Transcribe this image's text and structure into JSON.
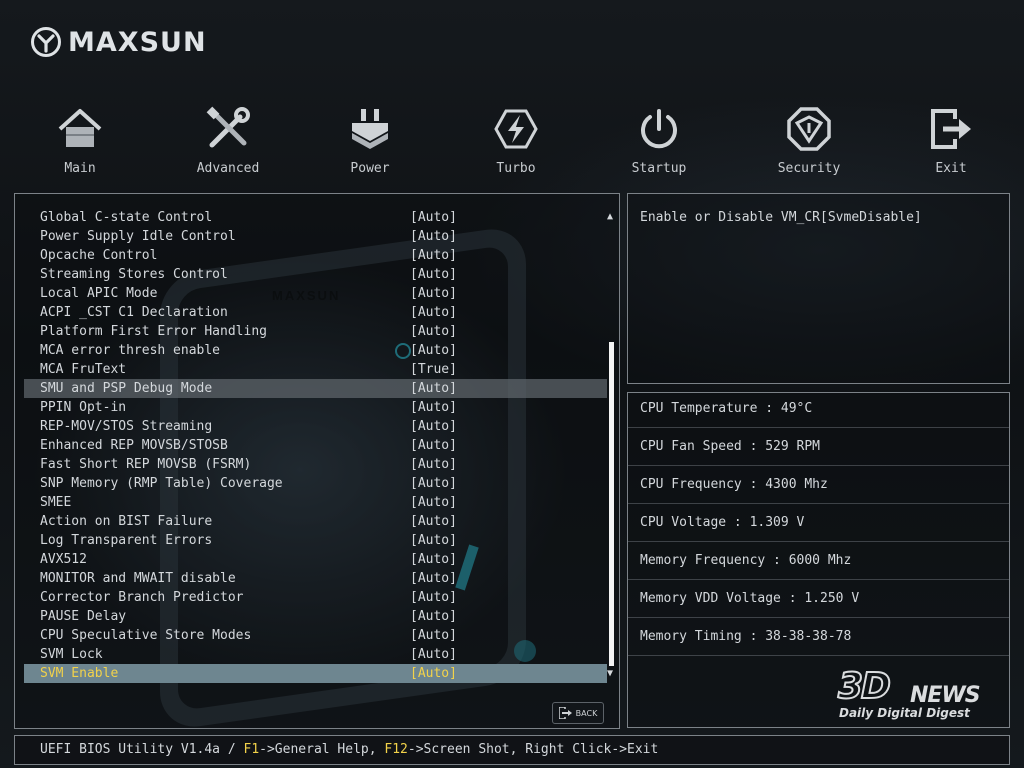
{
  "brand": {
    "name": "MAXSUN"
  },
  "background": {
    "watermark": "MAXSUN"
  },
  "nav": [
    {
      "label": "Main",
      "icon": "home-icon"
    },
    {
      "label": "Advanced",
      "icon": "tools-icon"
    },
    {
      "label": "Power",
      "icon": "power-chip-icon"
    },
    {
      "label": "Turbo",
      "icon": "lightning-icon"
    },
    {
      "label": "Startup",
      "icon": "power-button-icon"
    },
    {
      "label": "Security",
      "icon": "shield-icon"
    },
    {
      "label": "Exit",
      "icon": "exit-icon"
    }
  ],
  "settings": [
    {
      "label": "Global C-state Control",
      "value": "[Auto]"
    },
    {
      "label": "Power Supply Idle Control",
      "value": "[Auto]"
    },
    {
      "label": "Opcache Control",
      "value": "[Auto]"
    },
    {
      "label": "Streaming Stores Control",
      "value": "[Auto]"
    },
    {
      "label": "Local APIC Mode",
      "value": "[Auto]"
    },
    {
      "label": "ACPI _CST C1 Declaration",
      "value": "[Auto]"
    },
    {
      "label": "Platform First Error Handling",
      "value": "[Auto]"
    },
    {
      "label": "MCA error thresh enable",
      "value": "[Auto]"
    },
    {
      "label": "MCA FruText",
      "value": "[True]"
    },
    {
      "label": "SMU and PSP Debug Mode",
      "value": "[Auto]"
    },
    {
      "label": "PPIN Opt-in",
      "value": "[Auto]"
    },
    {
      "label": "REP-MOV/STOS Streaming",
      "value": "[Auto]"
    },
    {
      "label": "Enhanced REP MOVSB/STOSB",
      "value": "[Auto]"
    },
    {
      "label": "Fast Short REP MOVSB (FSRM)",
      "value": "[Auto]"
    },
    {
      "label": "SNP Memory (RMP Table) Coverage",
      "value": "[Auto]"
    },
    {
      "label": "SMEE",
      "value": "[Auto]"
    },
    {
      "label": "Action on BIST Failure",
      "value": "[Auto]"
    },
    {
      "label": "Log Transparent Errors",
      "value": "[Auto]"
    },
    {
      "label": "AVX512",
      "value": "[Auto]"
    },
    {
      "label": "MONITOR and MWAIT disable",
      "value": "[Auto]"
    },
    {
      "label": "Corrector Branch Predictor",
      "value": "[Auto]"
    },
    {
      "label": "PAUSE Delay",
      "value": "[Auto]"
    },
    {
      "label": "CPU Speculative Store Modes",
      "value": "[Auto]"
    },
    {
      "label": "SVM Lock",
      "value": "[Auto]"
    },
    {
      "label": "SVM Enable",
      "value": "[Auto]"
    }
  ],
  "state": {
    "hover_index": 9,
    "selected_index": 24
  },
  "scroll": {
    "up_glyph": "▲",
    "down_glyph": "▼"
  },
  "back_button": {
    "label": "BACK",
    "icon": "back-arrow-icon"
  },
  "help": {
    "text": "Enable or Disable VM_CR[SvmeDisable]"
  },
  "info": [
    {
      "text": "CPU Temperature : 49°C"
    },
    {
      "text": "CPU Fan Speed : 529 RPM"
    },
    {
      "text": "CPU Frequency : 4300 Mhz"
    },
    {
      "text": "CPU Voltage : 1.309 V"
    },
    {
      "text": "Memory Frequency : 6000 Mhz"
    },
    {
      "text": "Memory VDD Voltage : 1.250 V"
    },
    {
      "text": "Memory Timing : 38-38-38-78"
    }
  ],
  "watermark": {
    "logo": "3D",
    "word": "NEWS",
    "sub": "Daily Digital Digest"
  },
  "footer": {
    "prefix": "UEFI BIOS Utility V1.4a / ",
    "key1": "F1",
    "text1": "->General Help, ",
    "key2": "F12",
    "text2": "->Screen Shot, Right Click->Exit"
  },
  "colors": {
    "accent": "#f2d24a",
    "selected_bg": "#6e8690",
    "hover_bg": "#5f666c",
    "border": "#7c8288"
  }
}
